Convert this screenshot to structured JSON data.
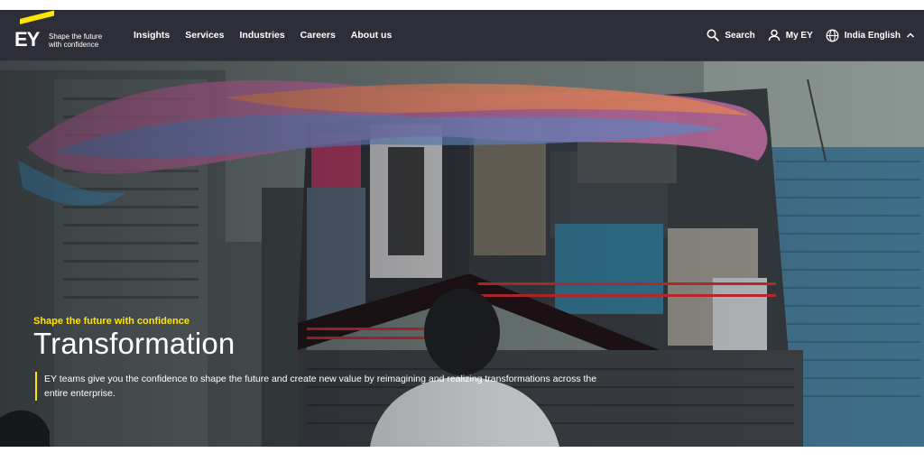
{
  "brand": {
    "logo_text": "EY",
    "tagline_line1": "Shape the future",
    "tagline_line2": "with confidence",
    "accent_color": "#ffe600",
    "nav_bg": "#2e2e38"
  },
  "nav": {
    "items": [
      {
        "label": "Insights"
      },
      {
        "label": "Services"
      },
      {
        "label": "Industries"
      },
      {
        "label": "Careers"
      },
      {
        "label": "About us"
      }
    ]
  },
  "utility": {
    "search_label": "Search",
    "search_icon": "search-icon",
    "account_label": "My EY",
    "account_icon": "user-icon",
    "locale_label": "India English",
    "locale_icon": "globe-icon",
    "locale_caret_icon": "chevron-up-icon"
  },
  "hero": {
    "eyebrow": "Shape the future with confidence",
    "title": "Transformation",
    "description": "EY teams give you the confidence to shape the future and create new value by reimagining and realizing transformations across the entire enterprise."
  }
}
